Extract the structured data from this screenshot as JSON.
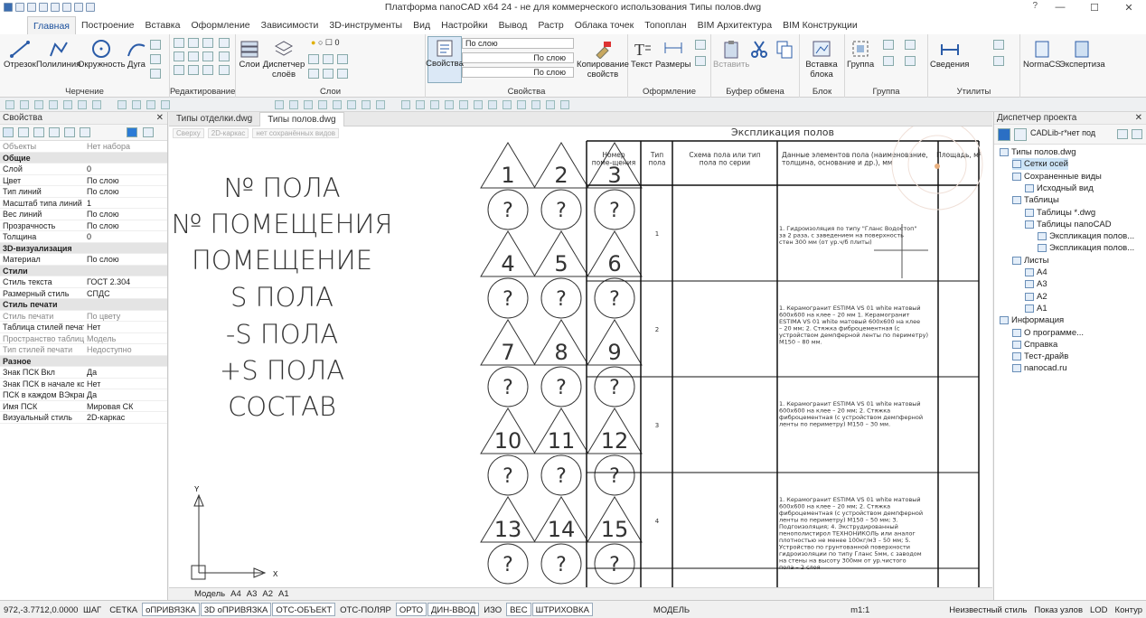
{
  "window": {
    "title": "Платформа nanoCAD x64 24 - не для коммерческого использования Типы полов.dwg"
  },
  "menu": {
    "tabs": [
      "Главная",
      "Построение",
      "Вставка",
      "Оформление",
      "Зависимости",
      "3D-инструменты",
      "Вид",
      "Настройки",
      "Вывод",
      "Растр",
      "Облака точек",
      "Топоплан",
      "BIM Архитектура",
      "BIM Конструкции"
    ]
  },
  "ribbon": {
    "drawing": {
      "label": "Черчение",
      "buttons": [
        "Отрезок",
        "Полилиния",
        "Окружность",
        "Дуга"
      ]
    },
    "editing": {
      "label": "Редактирование"
    },
    "layers": {
      "label": "Слои",
      "buttons": [
        "Слои",
        "Диспетчер слоёв"
      ],
      "current_layer": "0"
    },
    "properties": {
      "label": "Свойства",
      "button": "Свойства",
      "color": "По слою",
      "linetype": "По слою",
      "lineweight": "По слою",
      "copy_props": "Копирование свойств"
    },
    "format": {
      "label": "Оформление",
      "buttons": [
        "Текст",
        "Размеры"
      ]
    },
    "clipboard": {
      "label": "Буфер обмена",
      "buttons": [
        "Вставить"
      ]
    },
    "block": {
      "label": "Блок",
      "buttons": [
        "Вставка блока"
      ]
    },
    "group": {
      "label": "Группа",
      "buttons": [
        "Группа"
      ]
    },
    "utils": {
      "label": "Утилиты",
      "buttons": [
        "Сведения"
      ]
    },
    "extras": [
      "NormaCS",
      "Экспертиза"
    ]
  },
  "left_panel": {
    "title": "Свойства",
    "rows": [
      {
        "k": "Объекты",
        "v": "Нет набора",
        "type": "gray"
      },
      {
        "k": "Общие",
        "v": "",
        "type": "sec"
      },
      {
        "k": "Слой",
        "v": "0",
        "type": ""
      },
      {
        "k": "Цвет",
        "v": "По слою",
        "type": ""
      },
      {
        "k": "Тип линий",
        "v": "По слою",
        "type": ""
      },
      {
        "k": "Масштаб типа линий",
        "v": "1",
        "type": ""
      },
      {
        "k": "Вес линий",
        "v": "По слою",
        "type": ""
      },
      {
        "k": "Прозрачность",
        "v": "По слою",
        "type": ""
      },
      {
        "k": "Толщина",
        "v": "0",
        "type": ""
      },
      {
        "k": "3D-визуализация",
        "v": "",
        "type": "sec"
      },
      {
        "k": "Материал",
        "v": "По слою",
        "type": ""
      },
      {
        "k": "Стили",
        "v": "",
        "type": "sec"
      },
      {
        "k": "Стиль текста",
        "v": "ГОСТ 2.304",
        "type": ""
      },
      {
        "k": "Размерный стиль",
        "v": "СПДС",
        "type": ""
      },
      {
        "k": "Стиль печати",
        "v": "",
        "type": "sec"
      },
      {
        "k": "Стиль печати",
        "v": "По цвету",
        "type": "gray"
      },
      {
        "k": "Таблица стилей печати",
        "v": "Нет",
        "type": ""
      },
      {
        "k": "Пространство таблицы...",
        "v": "Модель",
        "type": "gray"
      },
      {
        "k": "Тип стилей печати",
        "v": "Недоступно",
        "type": "gray"
      },
      {
        "k": "Разное",
        "v": "",
        "type": "sec"
      },
      {
        "k": "Знак ПСК Вкл",
        "v": "Да",
        "type": ""
      },
      {
        "k": "Знак ПСК в начале коо...",
        "v": "Нет",
        "type": ""
      },
      {
        "k": "ПСК в каждом ВЭкране",
        "v": "Да",
        "type": ""
      },
      {
        "k": "Имя ПСК",
        "v": "Мировая СК",
        "type": ""
      },
      {
        "k": "Визуальный стиль",
        "v": "2D-каркас",
        "type": ""
      }
    ]
  },
  "doc_tabs": [
    "Типы отделки.dwg",
    "Типы полов.dwg"
  ],
  "view_bar": [
    "Сверху",
    "2D-каркас",
    "нет сохранённых видов"
  ],
  "canvas": {
    "labels": [
      "№ ПОЛА",
      "№ ПОМЕЩЕНИЯ",
      "ПОМЕЩЕНИЕ",
      "S ПОЛА",
      "-S ПОЛА",
      "+S ПОЛА",
      "СОСТАВ"
    ],
    "triangles": [
      "1",
      "2",
      "3",
      "4",
      "5",
      "6",
      "7",
      "8",
      "9",
      "10",
      "11",
      "12",
      "13",
      "14",
      "15"
    ],
    "circle_mark": "?",
    "ucs_x": "X",
    "ucs_y": "Y"
  },
  "table": {
    "title": "Экспликация полов",
    "headers": [
      "Номер поме-щения",
      "Тип пола",
      "Схема пола или тип пола по серии",
      "Данные элементов пола (наименование, толщина, основание и др.), мм",
      "Площадь, м²"
    ],
    "rows": [
      {
        "type": "1",
        "desc": "1. Гидроизоляция по типу \"Гланс Водостоп\" за 2 раза, с заведением на поверхность стен 300 мм (от ур.ч/б плиты)"
      },
      {
        "type": "2",
        "desc": "1. Керамогранит ESTIMA VS 01 white матовый 600х600 на клее – 20 мм 1. Керамогранит ESTIMA VS 01 white матовый 600х600 на клее – 20 мм; 2. Стяжка фиброцементная (с устройством демпферной ленты по периметру) М150 – 80 мм."
      },
      {
        "type": "3",
        "desc": "1. Керамогранит ESTIMA VS 01 white матовый 600х600 на клее – 20 мм; 2. Стяжка фиброцементная (с устройством демпферной ленты по периметру) М150 – 30 мм."
      },
      {
        "type": "4",
        "desc": "1. Керамогранит ESTIMA VS 01 white матовый 600х600 на клее – 20 мм; 2. Стяжка фиброцементная (с устройством демпферной ленты по периметру) М150 – 50 мм; 3. Подгоизоляция; 4. Экструдированный пенополистирол ТЕХНОНИКОЛЬ или аналог плотностью не менее 100кг/м3 – 50 мм; 5. Устройство по грунтованной поверхности гидроизоляции по типу Гланс 5мм, с заводом на стены на высоту 300мм от ур.чистого пола – 2 слоя"
      }
    ]
  },
  "model_tabs": [
    "Модель",
    "A4",
    "A3",
    "A2",
    "A1"
  ],
  "right_panel": {
    "title": "Диспетчер проекта",
    "toolbar_text": "CADLib-г*нет под",
    "tree": [
      {
        "label": "Типы полов.dwg",
        "level": 0,
        "sel": false
      },
      {
        "label": "Сетки осей",
        "level": 1,
        "sel": true
      },
      {
        "label": "Сохраненные виды",
        "level": 1,
        "sel": false
      },
      {
        "label": "Исходный вид",
        "level": 2,
        "sel": false
      },
      {
        "label": "Таблицы",
        "level": 1,
        "sel": false
      },
      {
        "label": "Таблицы *.dwg",
        "level": 2,
        "sel": false
      },
      {
        "label": "Таблицы nanoCAD",
        "level": 2,
        "sel": false
      },
      {
        "label": "Экспликация полов...",
        "level": 3,
        "sel": false
      },
      {
        "label": "Экспликация полов...",
        "level": 3,
        "sel": false
      },
      {
        "label": "Листы",
        "level": 1,
        "sel": false
      },
      {
        "label": "A4",
        "level": 2,
        "sel": false
      },
      {
        "label": "A3",
        "level": 2,
        "sel": false
      },
      {
        "label": "A2",
        "level": 2,
        "sel": false
      },
      {
        "label": "A1",
        "level": 2,
        "sel": false
      },
      {
        "label": "Информация",
        "level": 0,
        "sel": false
      },
      {
        "label": "О программе...",
        "level": 1,
        "sel": false
      },
      {
        "label": "Справка",
        "level": 1,
        "sel": false
      },
      {
        "label": "Тест-драйв",
        "level": 1,
        "sel": false
      },
      {
        "label": "nanocad.ru",
        "level": 1,
        "sel": false
      }
    ]
  },
  "status": {
    "coords": "972,-3.7712,0.0000",
    "toggles": [
      {
        "label": "ШАГ",
        "on": false
      },
      {
        "label": "СЕТКА",
        "on": false
      },
      {
        "label": "оПРИВЯЗКА",
        "on": true
      },
      {
        "label": "3D оПРИВЯЗКА",
        "on": true
      },
      {
        "label": "ОТС-ОБЪЕКТ",
        "on": true
      },
      {
        "label": "ОТС-ПОЛЯР",
        "on": false
      },
      {
        "label": "ОРТО",
        "on": true
      },
      {
        "label": "ДИН-ВВОД",
        "on": true
      },
      {
        "label": "ИЗО",
        "on": false
      },
      {
        "label": "ВЕС",
        "on": true
      },
      {
        "label": "ШТРИХОВКА",
        "on": true
      }
    ],
    "model": "МОДЕЛЬ",
    "scale": "m1:1",
    "style": "Неизвестный стиль",
    "nodes": "Показ узлов",
    "lod": "LOD",
    "contour": "Контур"
  }
}
